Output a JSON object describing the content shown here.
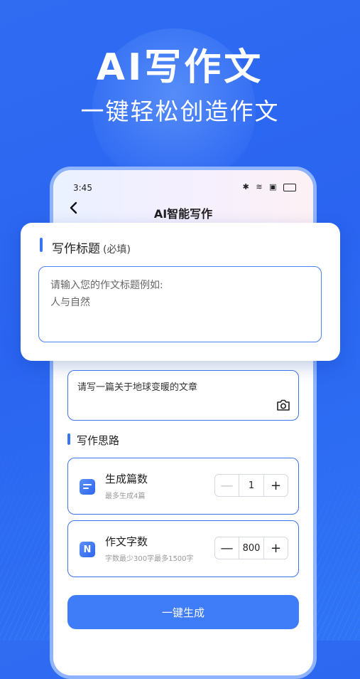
{
  "hero": {
    "title": "AI写作文",
    "subtitle": "一键轻松创造作文"
  },
  "status_bar": {
    "time": "3:45"
  },
  "nav": {
    "back_icon": "chevron-left-icon",
    "title": "AI智能写作"
  },
  "title_card": {
    "heading": "写作标题",
    "required_note": "(必填)",
    "placeholder_line1": "请输入您的作文标题例如:",
    "placeholder_line2": "人与自然"
  },
  "prompt": {
    "text": "请写一篇关于地球变暖的文章",
    "icon": "camera-icon"
  },
  "section": {
    "label": "写作思路"
  },
  "options": [
    {
      "icon": "list-card-icon",
      "icon_glyph": "",
      "title": "生成篇数",
      "desc": "最多生成4篇",
      "minus": "—",
      "value": "1",
      "plus": "+"
    },
    {
      "icon": "n-letter-icon",
      "icon_glyph": "N",
      "title": "作文字数",
      "desc": "字数最少300字最多1500字",
      "minus": "—",
      "value": "800",
      "plus": "+"
    }
  ],
  "generate_button": {
    "label": "一键生成"
  },
  "colors": {
    "background": "#2f6cf2",
    "accent": "#3f7cf7",
    "border": "#3d73f0"
  }
}
